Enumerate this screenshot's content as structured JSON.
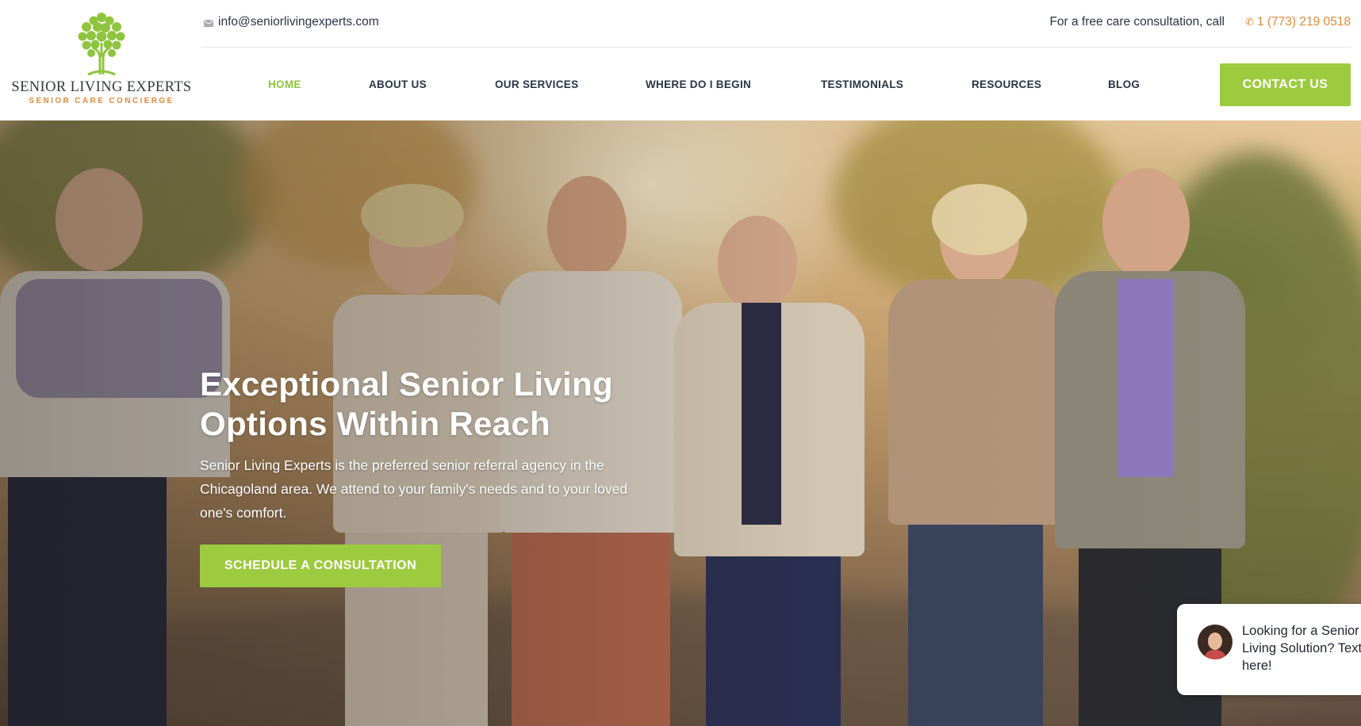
{
  "brand": {
    "name": "SENIOR LIVING EXPERTS",
    "tagline": "SENIOR CARE CONCIERGE",
    "colors": {
      "accent_green": "#9dcb3f",
      "accent_orange": "#e08a3a",
      "text_dark": "#2b3445"
    }
  },
  "topbar": {
    "email": "info@seniorlivingexperts.com",
    "email_icon": "envelope-icon",
    "call_text": "For a free care consultation, call",
    "phone": "1 (773) 219 0518",
    "phone_icon": "phone-icon"
  },
  "nav": {
    "items": [
      {
        "label": "HOME",
        "active": true
      },
      {
        "label": "ABOUT US",
        "active": false
      },
      {
        "label": "OUR SERVICES",
        "active": false
      },
      {
        "label": "WHERE DO I BEGIN",
        "active": false
      },
      {
        "label": "TESTIMONIALS",
        "active": false
      },
      {
        "label": "RESOURCES",
        "active": false
      },
      {
        "label": "BLOG",
        "active": false
      }
    ],
    "contact_label": "CONTACT US"
  },
  "hero": {
    "title_line1": "Exceptional Senior Living",
    "title_line2": "Options Within Reach",
    "text": "Senior Living Experts is the preferred senior referral agency in the Chicagoland area. We attend to your family's needs and to your loved one's comfort.",
    "cta_label": "SCHEDULE A CONSULTATION"
  },
  "chat": {
    "message": "Looking for a Senior Living Solution? Text here!"
  }
}
